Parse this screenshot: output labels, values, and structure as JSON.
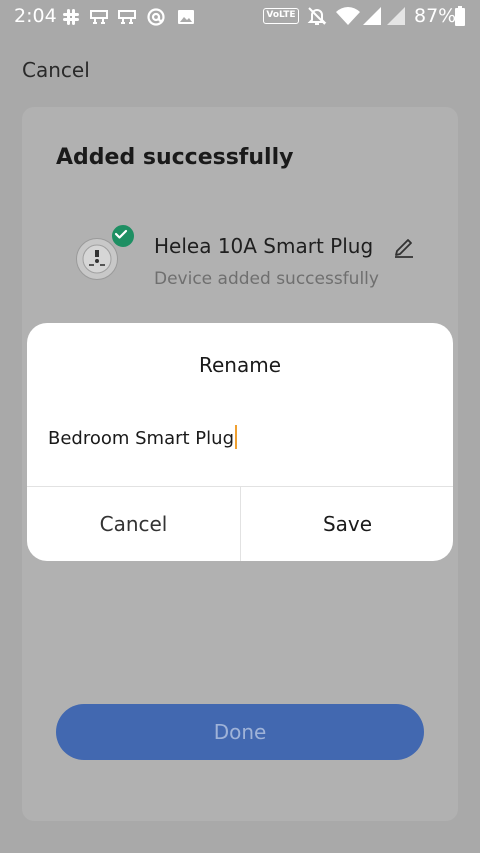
{
  "status_bar": {
    "time": "2:04",
    "volte": "VoLTE",
    "battery_percent": "87%"
  },
  "top_bar": {
    "cancel_label": "Cancel"
  },
  "card": {
    "title": "Added successfully",
    "device_name": "Helea 10A Smart Plug",
    "device_status": "Device added successfully",
    "done_label": "Done"
  },
  "dialog": {
    "title": "Rename",
    "input_value": "Bedroom Smart Plug",
    "cancel_label": "Cancel",
    "save_label": "Save"
  },
  "colors": {
    "primary": "#4268b0",
    "success": "#1e8f63",
    "caret": "#f0a030"
  }
}
